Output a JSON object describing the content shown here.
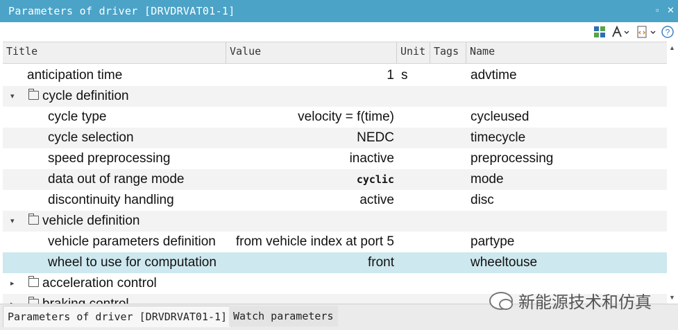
{
  "window": {
    "title": "Parameters of driver [DRVDRVAT01-1]",
    "maximize_glyph": "▫",
    "close_glyph": "✕"
  },
  "toolbar": {
    "icons": [
      "layout-icon",
      "font-icon",
      "code-icon",
      "help-icon"
    ],
    "help_glyph": "?"
  },
  "table": {
    "columns": [
      "Title",
      "Value",
      "Unit",
      "Tags",
      "Name"
    ],
    "rows": [
      {
        "title": "anticipation time",
        "value": "1",
        "unit": "s",
        "tags": "",
        "name": "advtime",
        "level": 0,
        "group": false
      },
      {
        "title": "cycle definition",
        "value": "",
        "unit": "",
        "tags": "",
        "name": "",
        "level": 0,
        "group": true,
        "expanded": true
      },
      {
        "title": "cycle type",
        "value": "velocity = f(time)",
        "unit": "",
        "tags": "",
        "name": "cycleused",
        "level": 1,
        "group": false
      },
      {
        "title": "cycle selection",
        "value": "NEDC",
        "unit": "",
        "tags": "",
        "name": "timecycle",
        "level": 1,
        "group": false
      },
      {
        "title": "speed preprocessing",
        "value": "inactive",
        "unit": "",
        "tags": "",
        "name": "preprocessing",
        "level": 1,
        "group": false
      },
      {
        "title": "data out of range mode",
        "value": "cyclic",
        "unit": "",
        "tags": "",
        "name": "mode",
        "level": 1,
        "group": false,
        "mono": true
      },
      {
        "title": "discontinuity handling",
        "value": "active",
        "unit": "",
        "tags": "",
        "name": "disc",
        "level": 1,
        "group": false
      },
      {
        "title": "vehicle definition",
        "value": "",
        "unit": "",
        "tags": "",
        "name": "",
        "level": 0,
        "group": true,
        "expanded": true
      },
      {
        "title": "vehicle parameters definition",
        "value": "from vehicle index at port 5",
        "unit": "",
        "tags": "",
        "name": "partype",
        "level": 1,
        "group": false
      },
      {
        "title": "wheel to use for computation",
        "value": "front",
        "unit": "",
        "tags": "",
        "name": "wheeltouse",
        "level": 1,
        "group": false,
        "selected": true
      },
      {
        "title": "acceleration control",
        "value": "",
        "unit": "",
        "tags": "",
        "name": "",
        "level": 0,
        "group": true,
        "expanded": false
      },
      {
        "title": "braking control",
        "value": "",
        "unit": "",
        "tags": "",
        "name": "",
        "level": 0,
        "group": true,
        "expanded": false
      }
    ]
  },
  "tabs": [
    {
      "label": "Parameters of driver [DRVDRVAT01-1]",
      "active": true
    },
    {
      "label": "Watch parameters",
      "active": false
    }
  ],
  "watermark": {
    "text": "新能源技术和仿真"
  },
  "colors": {
    "titlebar": "#4ba3c7",
    "selected_row": "#cde8ee",
    "alt_row": "#f3f3f3"
  }
}
